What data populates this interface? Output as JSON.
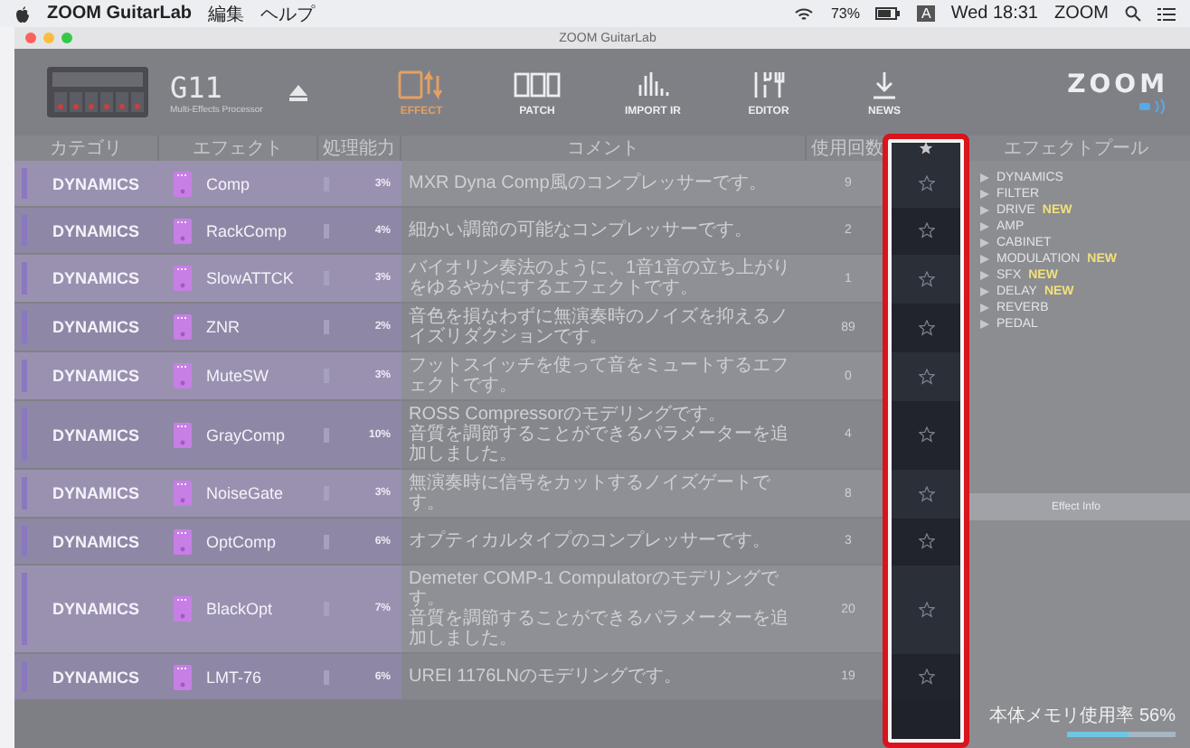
{
  "menubar": {
    "app": "ZOOM GuitarLab",
    "menus": [
      "編集",
      "ヘルプ"
    ],
    "battery": "73%",
    "input": "A",
    "clock": "Wed 18:31",
    "user": "ZOOM"
  },
  "window": {
    "title": "ZOOM GuitarLab"
  },
  "device": {
    "model": "G11",
    "subtitle": "Multi-Effects Processor"
  },
  "toolbar": [
    {
      "label": "EFFECT",
      "kind": "effect",
      "selected": true
    },
    {
      "label": "PATCH",
      "kind": "patch",
      "selected": false
    },
    {
      "label": "IMPORT IR",
      "kind": "import",
      "selected": false
    },
    {
      "label": "EDITOR",
      "kind": "editor",
      "selected": false
    },
    {
      "label": "NEWS",
      "kind": "news",
      "selected": false
    }
  ],
  "logo": "ZOOM",
  "columns": [
    "カテゴリ",
    "エフェクト",
    "処理能力",
    "コメント",
    "使用回数"
  ],
  "star_column": {
    "highlighted": true
  },
  "rows": [
    {
      "category": "DYNAMICS",
      "effect": "Comp",
      "load": "3%",
      "comment": [
        "MXR Dyna Comp風のコンプレッサーです。"
      ],
      "count": "9",
      "favorite": false
    },
    {
      "category": "DYNAMICS",
      "effect": "RackComp",
      "load": "4%",
      "comment": [
        "細かい調節の可能なコンプレッサーです。"
      ],
      "count": "2",
      "favorite": false
    },
    {
      "category": "DYNAMICS",
      "effect": "SlowATTCK",
      "load": "3%",
      "comment": [
        "バイオリン奏法のように、1音1音の立ち上がりをゆるやかにするエフェクトです。"
      ],
      "count": "1",
      "favorite": false
    },
    {
      "category": "DYNAMICS",
      "effect": "ZNR",
      "load": "2%",
      "comment": [
        "音色を損なわずに無演奏時のノイズを抑えるノイズリダクションです。"
      ],
      "count": "89",
      "favorite": false
    },
    {
      "category": "DYNAMICS",
      "effect": "MuteSW",
      "load": "3%",
      "comment": [
        "フットスイッチを使って音をミュートするエフェクトです。"
      ],
      "count": "0",
      "favorite": false
    },
    {
      "category": "DYNAMICS",
      "effect": "GrayComp",
      "load": "10%",
      "comment": [
        "ROSS Compressorのモデリングです。",
        "音質を調節することができるパラメーターを追加しました。"
      ],
      "count": "4",
      "favorite": false
    },
    {
      "category": "DYNAMICS",
      "effect": "NoiseGate",
      "load": "3%",
      "comment": [
        "無演奏時に信号をカットするノイズゲートです。"
      ],
      "count": "8",
      "favorite": false
    },
    {
      "category": "DYNAMICS",
      "effect": "OptComp",
      "load": "6%",
      "comment": [
        "オプティカルタイプのコンプレッサーです。"
      ],
      "count": "3",
      "favorite": false
    },
    {
      "category": "DYNAMICS",
      "effect": "BlackOpt",
      "load": "7%",
      "comment": [
        "Demeter COMP-1 Compulatorのモデリングです。",
        "音質を調節することができるパラメーターを追加しました。"
      ],
      "count": "20",
      "favorite": false
    },
    {
      "category": "DYNAMICS",
      "effect": "LMT-76",
      "load": "6%",
      "comment": [
        "UREI 1176LNのモデリングです。"
      ],
      "count": "19",
      "favorite": false
    }
  ],
  "pool": {
    "title": "エフェクトプール",
    "categories": [
      {
        "label": "DYNAMICS"
      },
      {
        "label": "FILTER"
      },
      {
        "label": "DRIVE",
        "badge": "NEW"
      },
      {
        "label": "AMP"
      },
      {
        "label": "CABINET"
      },
      {
        "label": "MODULATION",
        "badge": "NEW"
      },
      {
        "label": "SFX",
        "badge": "NEW"
      },
      {
        "label": "DELAY",
        "badge": "NEW"
      },
      {
        "label": "REVERB"
      },
      {
        "label": "PEDAL"
      }
    ],
    "info": "Effect Info"
  },
  "memory": {
    "label": "本体メモリ使用率",
    "reading": "56%",
    "level": 0.56
  }
}
